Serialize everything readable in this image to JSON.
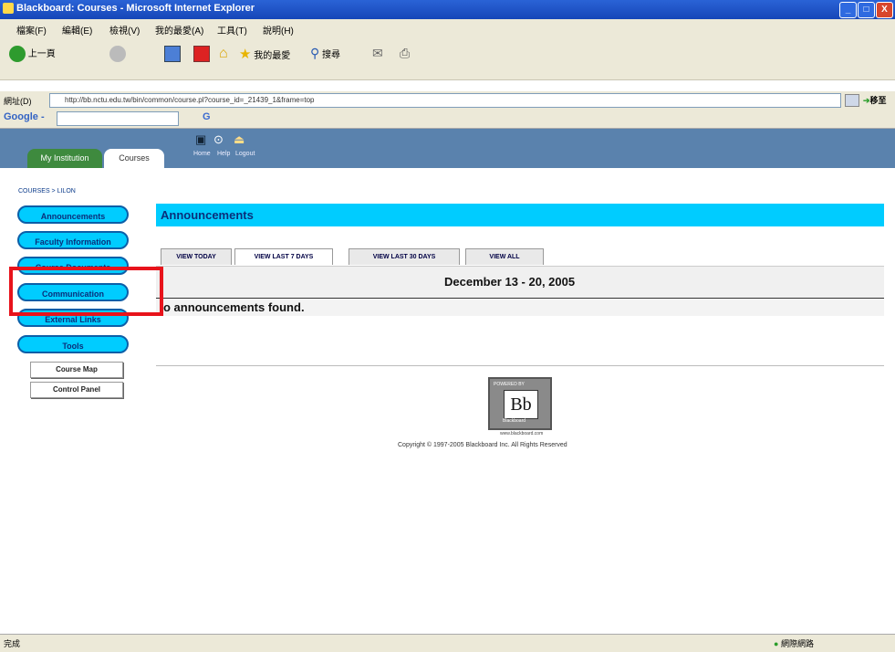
{
  "window": {
    "title": "Blackboard: Courses - Microsoft Internet Explorer",
    "min": "_",
    "max": "□",
    "close": "X"
  },
  "menu": {
    "items": [
      "檔案(F)",
      "編輯(E)",
      "檢視(V)",
      "我的最愛(A)",
      "工具(T)",
      "說明(H)"
    ]
  },
  "toolbar": {
    "back": "上一頁",
    "favorites": "我的最愛",
    "search": "搜尋"
  },
  "address": {
    "label": "網址(D)",
    "url": "http://bb.nctu.edu.tw/bin/common/course.pl?course_id=_21439_1&frame=top",
    "go": "移至"
  },
  "google": {
    "label": "Google -",
    "go": "G"
  },
  "bb_header": {
    "tab_institution": "My Institution",
    "tab_courses": "Courses",
    "icon_home": "Home",
    "icon_help": "Help",
    "icon_logout": "Logout"
  },
  "breadcrumb": "COURSES > LILON",
  "nav": {
    "buttons": [
      "Announcements",
      "Faculty Information",
      "Course Documents",
      "Communication",
      "External Links",
      "Tools"
    ],
    "small": [
      "Course Map",
      "Control Panel"
    ]
  },
  "announcements": {
    "title": "Announcements",
    "tabs": [
      "VIEW TODAY",
      "VIEW LAST 7 DAYS",
      "VIEW LAST 30 DAYS",
      "VIEW ALL"
    ],
    "date_range": "December 13 - 20, 2005",
    "empty": "o announcements found."
  },
  "footer": {
    "logo_top": "POWERED BY",
    "logo_main": "Bb",
    "logo_sub": "Blackboard",
    "logo_url": "www.blackboard.com",
    "copyright": "Copyright © 1997-2005 Blackboard Inc. All Rights Reserved"
  },
  "status": {
    "left": "完成",
    "right": "網際網路"
  },
  "colors": {
    "nav": "#00ccff",
    "header": "#5a82ad",
    "highlight": "#e8131b"
  }
}
